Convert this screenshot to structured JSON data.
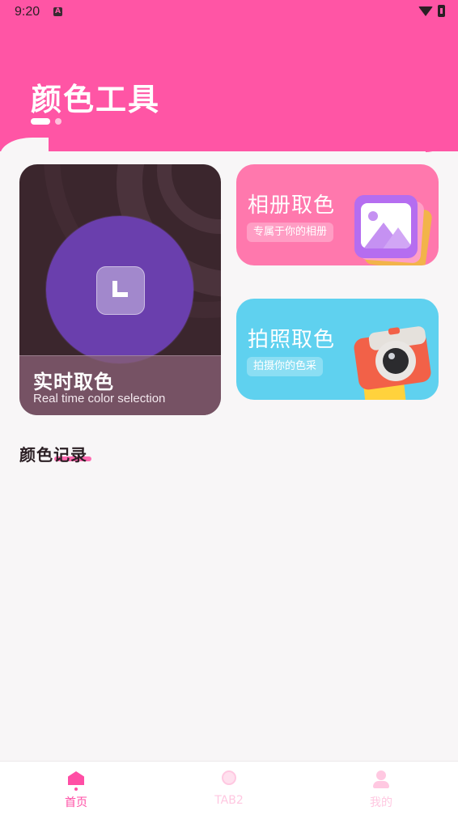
{
  "status_bar": {
    "time": "9:20",
    "app_badge": "A"
  },
  "header": {
    "title": "颜色工具",
    "pager": {
      "count": 2,
      "active_index": 0
    }
  },
  "cards": {
    "realtime": {
      "title": "实时取色",
      "subtitle": "Real time color selection",
      "icon": "crop-corner-icon"
    },
    "album": {
      "title": "相册取色",
      "tag": "专属于你的相册",
      "icon": "photo-gallery-icon",
      "color": "#ff78ad"
    },
    "camera": {
      "title": "拍照取色",
      "tag": "拍摄你的色采",
      "icon": "camera-icon",
      "color": "#5fd1ef"
    }
  },
  "records": {
    "title": "颜色记录"
  },
  "bottom_nav": {
    "items": [
      {
        "label": "首页",
        "icon": "home-icon",
        "active": true
      },
      {
        "label": "TAB2",
        "icon": "bulb-icon",
        "active": false
      },
      {
        "label": "我的",
        "icon": "user-icon",
        "active": false
      }
    ],
    "active_color": "#ff4ea5",
    "inactive_color": "#ffc8e1"
  },
  "theme": {
    "accent": "#ff55a5",
    "background": "#f8f6f7"
  }
}
